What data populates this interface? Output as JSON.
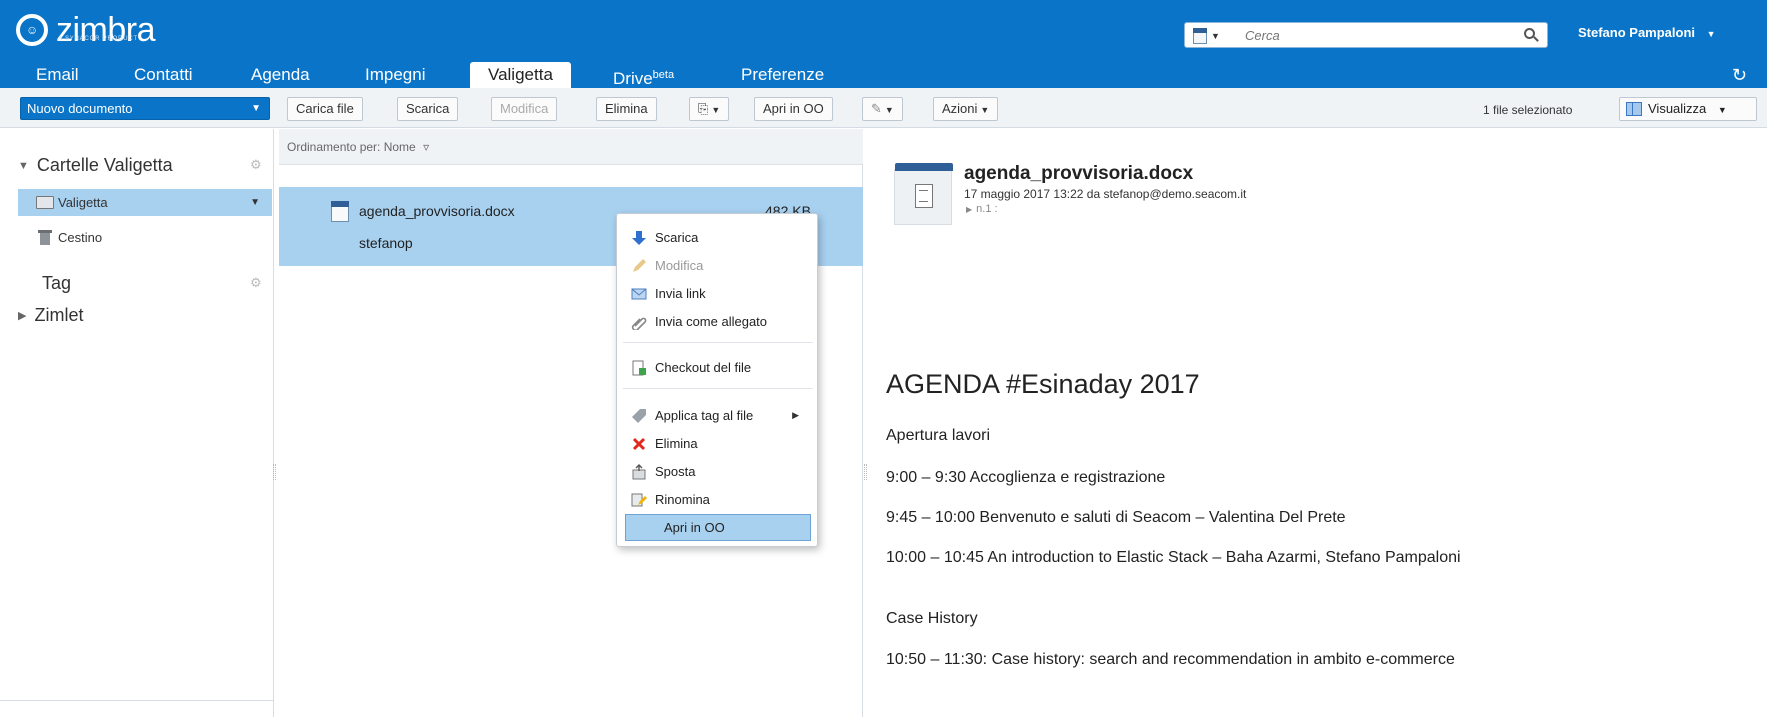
{
  "header": {
    "logo_text": "zimbra",
    "logo_sub": "A SYNACOR PRODUCT",
    "search_placeholder": "Cerca",
    "user_name": "Stefano Pampaloni"
  },
  "tabs": [
    {
      "label": "Email"
    },
    {
      "label": "Contatti"
    },
    {
      "label": "Agenda"
    },
    {
      "label": "Impegni"
    },
    {
      "label": "Valigetta",
      "active": true
    },
    {
      "label": "Drive",
      "sup": "beta"
    },
    {
      "label": "Preferenze"
    }
  ],
  "toolbar": {
    "new_doc": "Nuovo documento",
    "upload": "Carica file",
    "download": "Scarica",
    "edit": "Modifica",
    "delete": "Elimina",
    "open_oo": "Apri in OO",
    "actions": "Azioni",
    "selected_count": "1 file selezionato",
    "view": "Visualizza"
  },
  "sidebar": {
    "briefcase_header": "Cartelle Valigetta",
    "folders": [
      {
        "label": "Valigetta",
        "selected": true
      },
      {
        "label": "Cestino"
      }
    ],
    "tag_header": "Tag",
    "zimlet_header": "Zimlet"
  },
  "list": {
    "sort_label": "Ordinamento per: Nome",
    "file": {
      "name": "agenda_provvisoria.docx",
      "owner": "stefanop",
      "size": "482 KB"
    }
  },
  "context_menu": {
    "items": [
      {
        "label": "Scarica",
        "icon": "download-arrow-icon"
      },
      {
        "label": "Modifica",
        "icon": "pencil-icon",
        "disabled": true
      },
      {
        "label": "Invia link",
        "icon": "email-link-icon"
      },
      {
        "label": "Invia come allegato",
        "icon": "paperclip-icon"
      },
      {
        "label": "Checkout del file",
        "icon": "checkout-icon"
      },
      {
        "label": "Applica tag al file",
        "icon": "tag-icon"
      },
      {
        "label": "Elimina",
        "icon": "red-x-icon"
      },
      {
        "label": "Sposta",
        "icon": "move-icon"
      },
      {
        "label": "Rinomina",
        "icon": "rename-icon"
      },
      {
        "label": "Apri in OO",
        "highlighted": true
      }
    ]
  },
  "preview": {
    "title": "agenda_provvisoria.docx",
    "meta": "17 maggio 2017 13:22 da stefanop@demo.seacom.it",
    "version": "n.1 :",
    "heading": "AGENDA #Esinaday 2017",
    "lines": [
      "Apertura lavori",
      "9:00 – 9:30 Accoglienza e registrazione",
      "9:45 – 10:00 Benvenuto e saluti di Seacom – Valentina Del Prete",
      "10:00 – 10:45 An introduction to Elastic Stack – Baha Azarmi, Stefano Pampaloni",
      "Case History",
      "10:50 – 11:30: Case history: search and recommendation in ambito e-commerce"
    ]
  },
  "colors": {
    "brand_blue": "#0a75c8",
    "selection": "#a8d1f0",
    "toolbar_bg": "#f0f3f6"
  }
}
